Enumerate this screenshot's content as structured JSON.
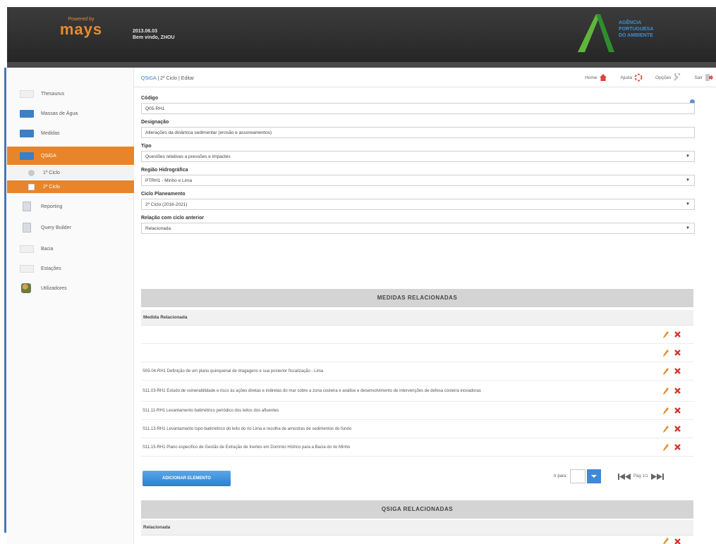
{
  "header": {
    "powered": "Powered by",
    "brand": "mays",
    "date": "2013.06.03",
    "welcome": "Bem vindo, ZHOU",
    "agency_lines": [
      "AGÊNCIA",
      "PORTUGUESA",
      "DO AMBIENTE"
    ]
  },
  "sidebar": {
    "items": [
      {
        "label": "Thesaurus",
        "icon": "folder-icon"
      },
      {
        "label": "Massas de Água",
        "icon": "folder-icon"
      },
      {
        "label": "Medidas",
        "icon": "folder-icon"
      },
      {
        "label": "QSiGA",
        "icon": "folder-icon"
      },
      {
        "label": "1º Ciclo",
        "icon": "gear-icon"
      },
      {
        "label": "2º Ciclo",
        "icon": "document-icon"
      },
      {
        "label": "Reporting",
        "icon": "document-icon"
      },
      {
        "label": "Query Builder",
        "icon": "document-icon"
      },
      {
        "label": "Bacia",
        "icon": "folder-icon"
      },
      {
        "label": "Estações",
        "icon": "folder-icon"
      },
      {
        "label": "Utilizadores",
        "icon": "users-icon"
      }
    ]
  },
  "breadcrumb": {
    "link": "QSiGA",
    "rest": " | 2º Ciclo | Editar"
  },
  "actions": {
    "home": "Home",
    "help": "Ajuda",
    "options": "Opções",
    "exit": "Sair"
  },
  "form": {
    "codigo_label": "Código",
    "codigo_value": "Q05-RH1",
    "designacao_label": "Designação",
    "designacao_value": "Alterações da dinâmica sedimentar (erosão e assoreamentos)",
    "tipo_label": "Tipo",
    "tipo_value": "Questões relativas a pressões e impactes",
    "regiao_label": "Região Hidrográfica",
    "regiao_value": "PTRH1 - Minho e Lima",
    "ciclo_label": "Ciclo Planeamento",
    "ciclo_value": "2º Ciclo (2016-2021)",
    "relacao_label": "Relação com ciclo anterior",
    "relacao_value": "Relacionada"
  },
  "medidas": {
    "title": "MEDIDAS RELACIONADAS",
    "column": "Medida Relacionada",
    "rows": [
      "",
      "",
      "S05.04-RH1 Definição de um plano quinquenal de dragagens e sua posterior fiscalização - Lima",
      "S11.03-RH1 Estudo de vulnerabilidade e risco às ações diretas e indiretas do mar sobre a zona costeira e análise e desenvolvimento de intervenções de defesa costeira inovadoras",
      "S11.11-RH1 Levantamento batimétrico periódico dos leitos dos afluentes",
      "S11.13-RH1 Levantamento topo-batimétrico do leito do rio Lima e recolha de amostras de sedimentos do fundo",
      "S11.15-RH1 Plano específico de Gestão de Extração de Inertes em Domínio Hídrico para a Bacia do rio Minho"
    ],
    "add_button": "ADICIONAR ELEMENTO",
    "goto_label": "Ir para:",
    "page_info": "Pág 1/1"
  },
  "qsiga": {
    "title": "QSIGA RELACIONADAS",
    "column": "Relacionada"
  }
}
